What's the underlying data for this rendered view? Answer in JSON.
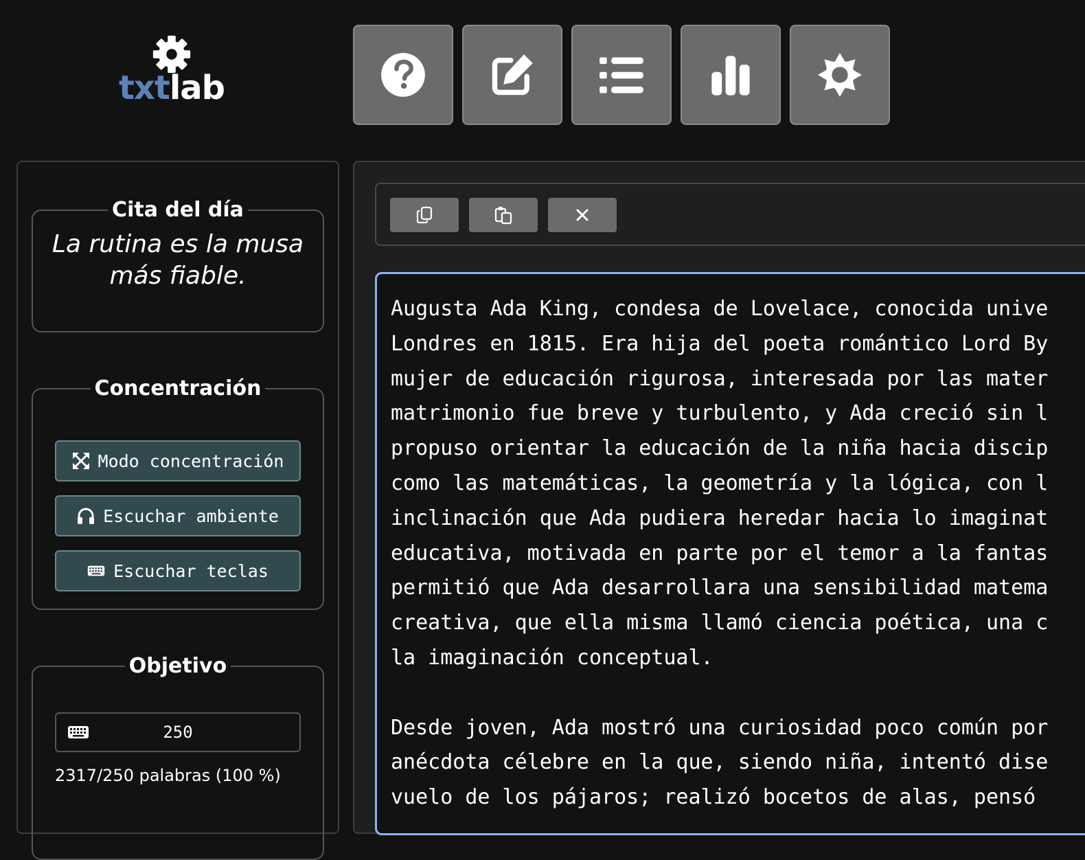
{
  "app": {
    "logo_part1": "txt",
    "logo_part2": "lab",
    "accent_color": "#5b83b8"
  },
  "toolbar": {
    "buttons": [
      {
        "icon": "help-icon"
      },
      {
        "icon": "edit-icon"
      },
      {
        "icon": "list-icon"
      },
      {
        "icon": "stats-icon"
      },
      {
        "icon": "theme-icon"
      }
    ]
  },
  "sidebar": {
    "quote": {
      "legend": "Cita del día",
      "text": "La rutina es la musa más fiable."
    },
    "focus": {
      "legend": "Concentración",
      "buttons": [
        {
          "icon": "focus-mode-icon",
          "label": "Modo concentración"
        },
        {
          "icon": "headphones-icon",
          "label": "Escuchar ambiente"
        },
        {
          "icon": "keyboard-icon",
          "label": "Escuchar teclas"
        }
      ]
    },
    "goal": {
      "legend": "Objetivo",
      "input_icon": "keyboard-icon",
      "value": "250",
      "status": "2317/250 palabras (100 %)"
    }
  },
  "editor": {
    "toolbar": [
      {
        "icon": "copy-icon"
      },
      {
        "icon": "paste-icon"
      },
      {
        "icon": "clear-icon"
      }
    ],
    "lines": [
      "Augusta Ada King, condesa de Lovelace, conocida unive",
      "Londres en 1815. Era hija del poeta romántico Lord By",
      "mujer de educación rigurosa, interesada por las mater",
      "matrimonio fue breve y turbulento, y Ada creció sin l",
      "propuso orientar la educación de la niña hacia discip",
      "como las matemáticas, la geometría y la lógica, con l",
      "inclinación que Ada pudiera heredar hacia lo imaginat",
      "educativa, motivada en parte por el temor a la fantas",
      "permitió que Ada desarrollara una sensibilidad matema",
      "creativa, que ella misma llamó ciencia poética, una c",
      "la imaginación conceptual.",
      "",
      "Desde joven, Ada mostró una curiosidad poco común por",
      "anécdota célebre en la que, siendo niña, intentó dise",
      "vuelo de los pájaros; realizó bocetos de alas, pensó"
    ]
  }
}
